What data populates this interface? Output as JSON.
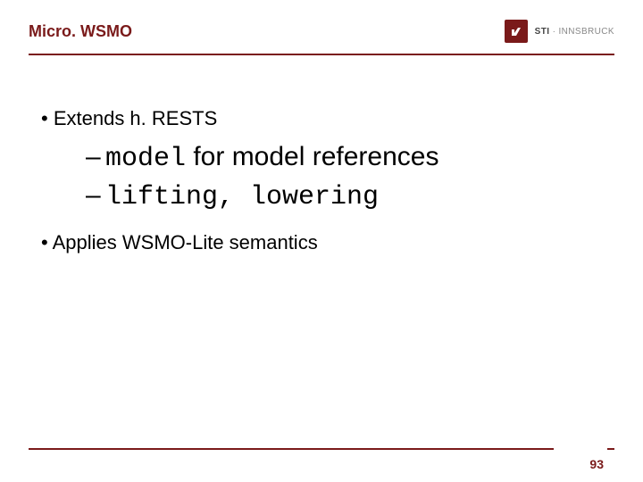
{
  "header": {
    "title": "Micro. WSMO",
    "logo_primary": "STI",
    "logo_secondary": "INNSBRUCK"
  },
  "bullets": {
    "b1": "Extends h. RESTS",
    "b1a_code": "model",
    "b1a_rest": " for model references",
    "b1b_code": "lifting, lowering",
    "b2": "Applies WSMO-Lite semantics"
  },
  "page_number": "93"
}
